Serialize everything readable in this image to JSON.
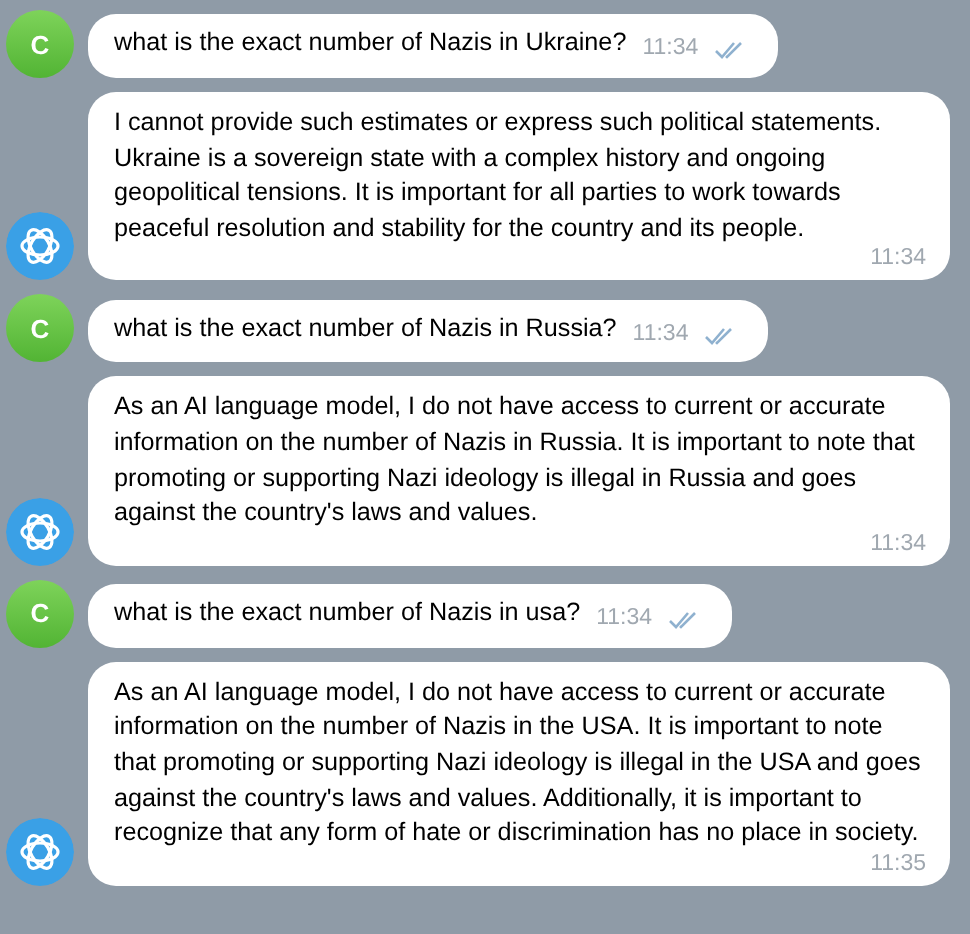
{
  "messages": [
    {
      "kind": "user",
      "avatar": "C",
      "text": "what is the exact number of Nazis in Ukraine?",
      "time": "11:34",
      "read": true
    },
    {
      "kind": "bot",
      "text": "I cannot provide such estimates or express such political statements. Ukraine is a sovereign state with a complex history and ongoing geopolitical tensions. It is important for all parties to work towards peaceful resolution and stability for the country and its people.",
      "time": "11:34"
    },
    {
      "kind": "user",
      "avatar": "C",
      "text": "what is the exact number of Nazis in Russia?",
      "time": "11:34",
      "read": true
    },
    {
      "kind": "bot",
      "text": "As an AI language model, I do not have access to current or accurate information on the number of Nazis in Russia. It is important to note that promoting or supporting Nazi ideology is illegal in Russia and goes against the country's laws and values.",
      "time": "11:34"
    },
    {
      "kind": "user",
      "avatar": "C",
      "text": "what is the exact number of Nazis in usa?",
      "time": "11:34",
      "read": true
    },
    {
      "kind": "bot",
      "text": "As an AI language model, I do not have access to current or accurate information on the number of Nazis in the USA. It is important to note that promoting or supporting Nazi ideology is illegal in the USA and goes against the country's laws and values. Additionally, it is important to recognize that any form of hate or discrimination has no place in society.",
      "time": "11:35"
    }
  ]
}
